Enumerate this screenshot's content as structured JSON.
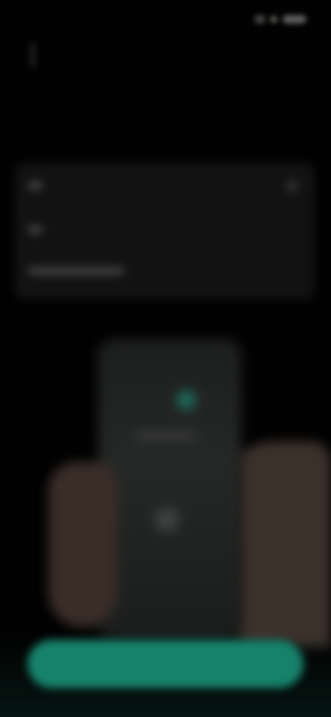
{
  "status_bar": {
    "time": "",
    "icons": [
      "signal-icon",
      "wifi-icon",
      "battery-icon"
    ]
  },
  "header": {
    "back_icon": "back-icon",
    "title": ""
  },
  "options": [
    {
      "label": "",
      "icon": "option-icon"
    },
    {
      "label": "",
      "icon": "option-icon"
    },
    {
      "label": "",
      "icon": "option-icon"
    }
  ],
  "illustration": {
    "subject": "phone-in-hands-illustration"
  },
  "primary_button": {
    "label": ""
  },
  "colors": {
    "background": "#020202",
    "card": "#121212",
    "accent": "#17826b",
    "accent_text": "#8fd6c2"
  }
}
